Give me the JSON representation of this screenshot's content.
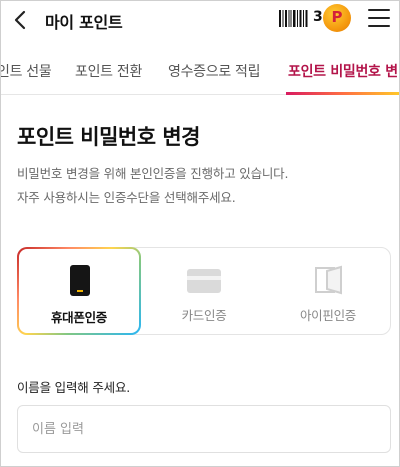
{
  "header": {
    "title": "마이 포인트",
    "barcode_count": "3",
    "point_badge_letter": "P"
  },
  "tabs": [
    {
      "label": "인트 선물",
      "active": false
    },
    {
      "label": "포인트 전환",
      "active": false
    },
    {
      "label": "영수증으로 적립",
      "active": false
    },
    {
      "label": "포인트 비밀번호 변",
      "active": true
    }
  ],
  "main": {
    "title": "포인트 비밀번호 변경",
    "description_lines": [
      "비밀번호 변경을 위해 본인인증을 진행하고 있습니다.",
      "자주 사용하시는 인증수단을 선택해주세요."
    ],
    "methods": [
      {
        "label": "휴대폰인증",
        "icon": "phone-icon",
        "selected": true
      },
      {
        "label": "카드인증",
        "icon": "card-icon",
        "selected": false
      },
      {
        "label": "아이핀인증",
        "icon": "ipin-icon",
        "selected": false
      }
    ],
    "name_field": {
      "label": "이름을 입력해 주세요.",
      "placeholder": "이름 입력",
      "value": ""
    }
  },
  "colors": {
    "accent": "#b3144a",
    "text_primary": "#111111",
    "text_secondary": "#6a6a6a"
  }
}
